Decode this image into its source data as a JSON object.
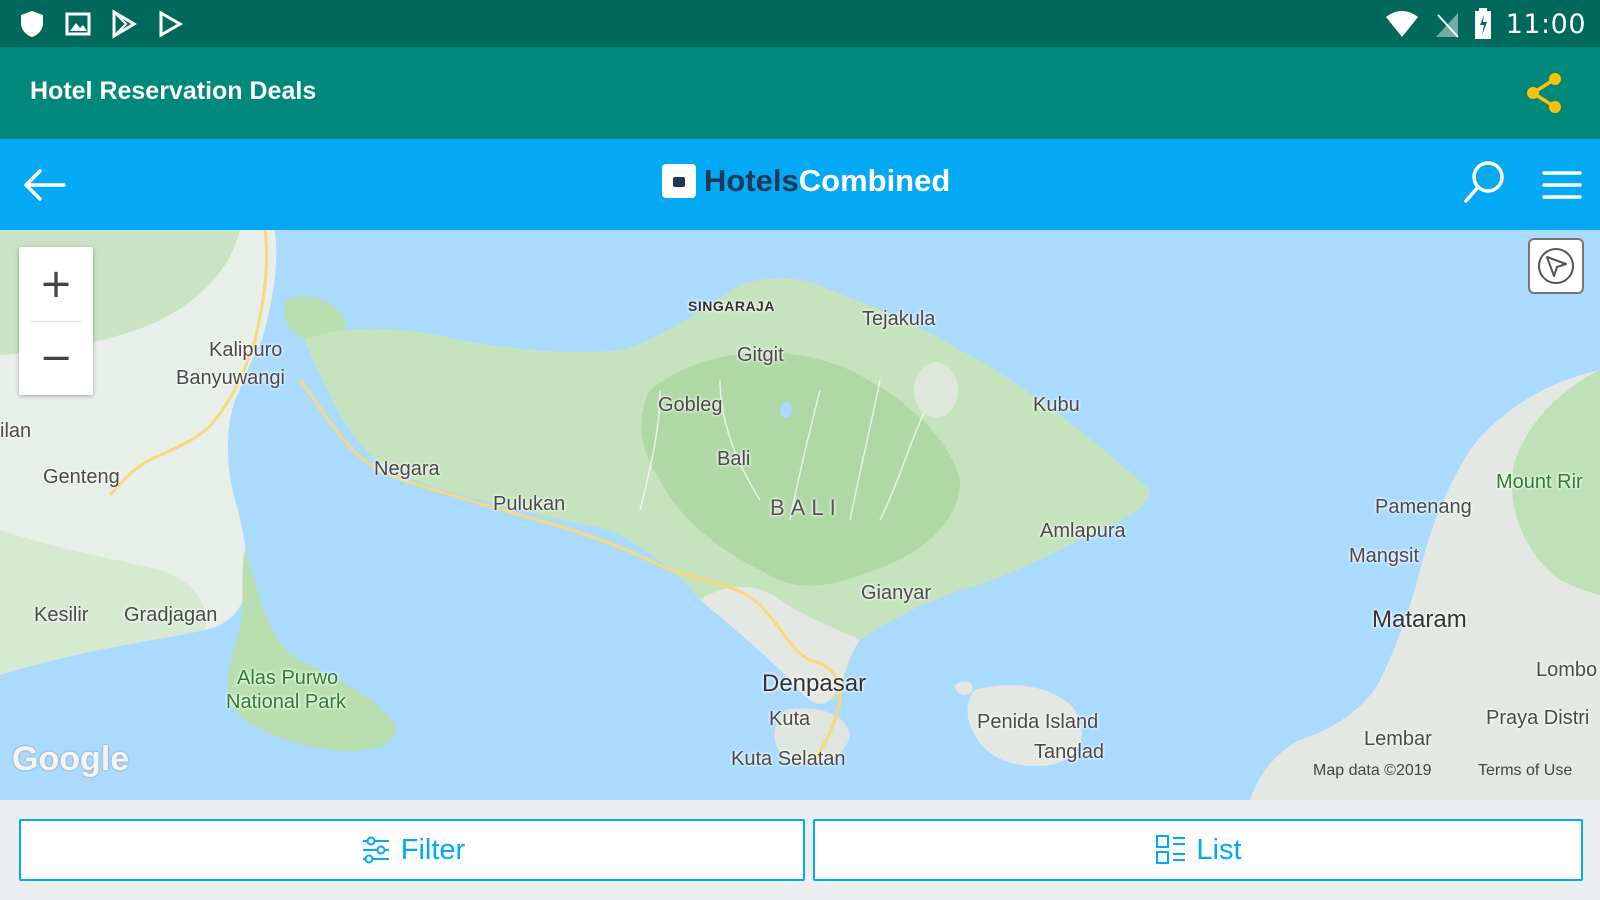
{
  "statusbar": {
    "time": "11:00",
    "icons": [
      "shield-icon",
      "image-icon",
      "play-store-icon",
      "play-icon",
      "wifi-icon",
      "no-signal-icon",
      "battery-icon"
    ]
  },
  "appbar": {
    "title": "Hotel Reservation Deals",
    "share_icon": "share-icon",
    "share_color": "#ffc107"
  },
  "hcbar": {
    "logo_part1": "Hotels",
    "logo_part2": "Combined",
    "back_icon": "arrow-left-icon",
    "search_icon": "search-icon",
    "menu_icon": "hamburger-menu-icon"
  },
  "map": {
    "labels": {
      "singaraja": "SINGARAJA",
      "tejakula": "Tejakula",
      "gitgit": "Gitgit",
      "kalipuro": "Kalipuro",
      "banyuwangi": "Banyuwangi",
      "gobleg": "Gobleg",
      "kubu": "Kubu",
      "lan": "ilan",
      "bali_small": "Bali",
      "negara": "Negara",
      "genteng": "Genteng",
      "pulukan": "Pulukan",
      "bali_region": "BALI",
      "mount": "Mount Rir",
      "pamenang": "Pamenang",
      "amlapura": "Amlapura",
      "mangsit": "Mangsit",
      "gianyar": "Gianyar",
      "kesilir": "Kesilir",
      "gradjagan": "Gradjagan",
      "mataram": "Mataram",
      "alas_purwo": "Alas Purwo",
      "national_park": "National Park",
      "lombo": "Lombo",
      "denpasar": "Denpasar",
      "kuta": "Kuta",
      "penida": "Penida Island",
      "praya": "Praya Distri",
      "tanglad": "Tanglad",
      "lembar": "Lembar",
      "kuta_selatan": "Kuta Selatan"
    },
    "google": "Google",
    "map_data": "Map data ©2019",
    "terms": "Terms of Use",
    "zoom_in": "+",
    "zoom_out": "−"
  },
  "bottom": {
    "filter_label": "Filter",
    "list_label": "List",
    "accent": "#03a9f4"
  }
}
